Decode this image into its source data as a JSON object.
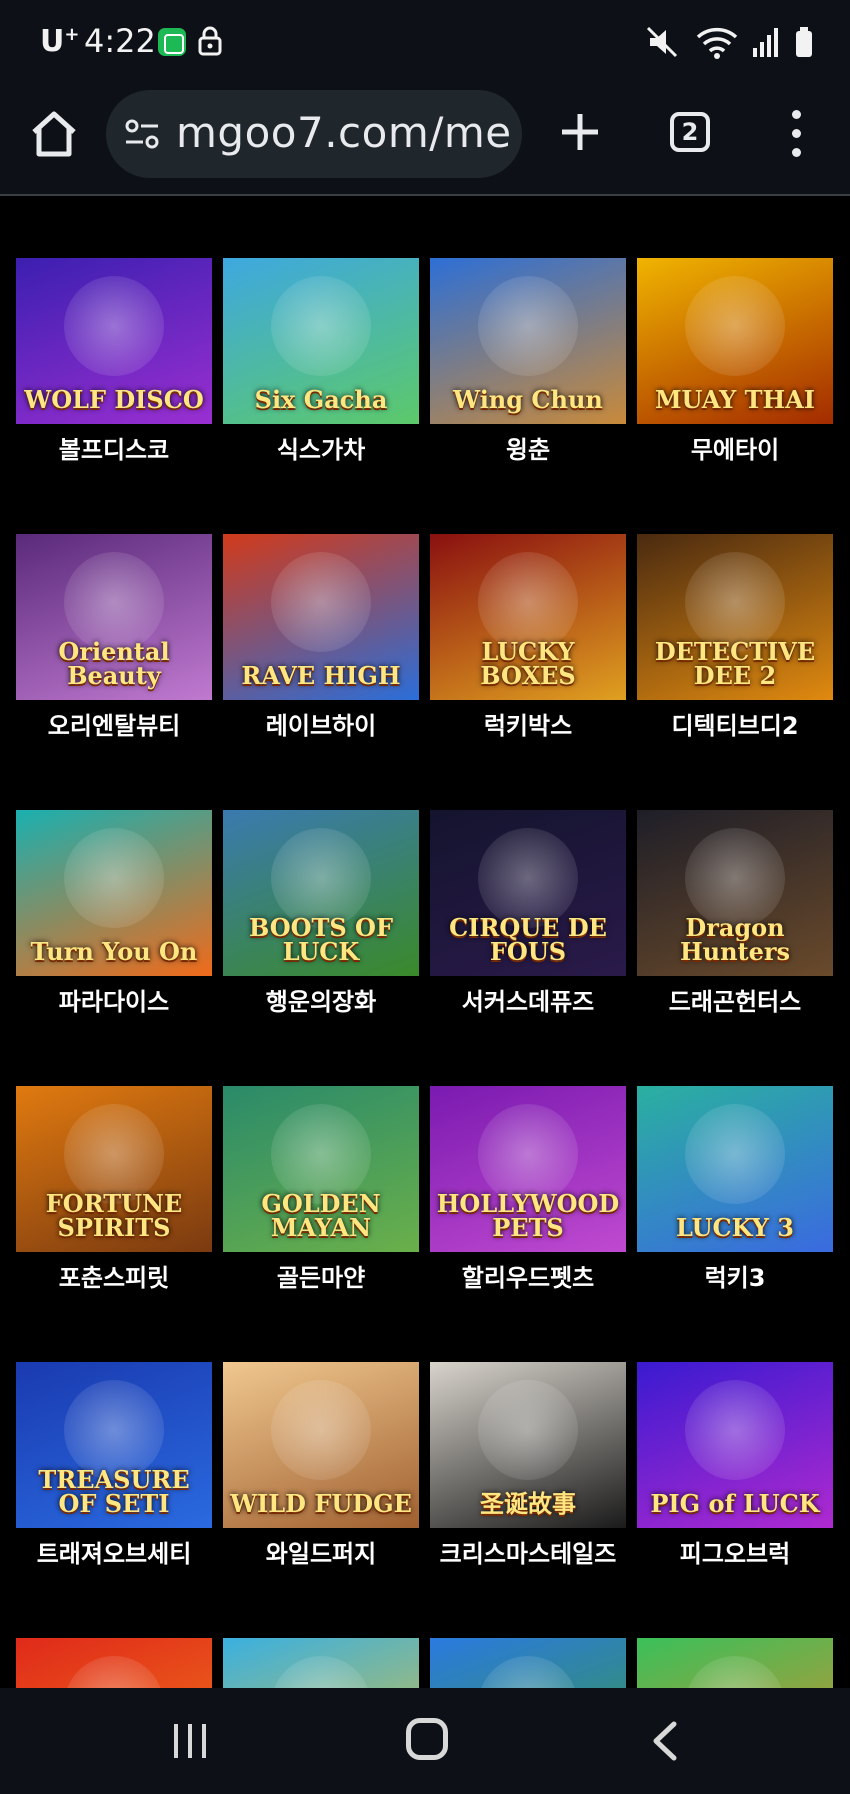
{
  "status": {
    "carrier": "U",
    "carrier_sup": "+",
    "time": "4:22"
  },
  "browser": {
    "url": "mgoo7.com/me",
    "tab_count": "2"
  },
  "games": [
    {
      "name": "볼프디스코",
      "art_text": "WOLF DISCO",
      "colors": [
        "#3b1fb0",
        "#9a2fd1"
      ]
    },
    {
      "name": "식스가차",
      "art_text": "Six Gacha",
      "colors": [
        "#3ea8e0",
        "#5cc96a"
      ]
    },
    {
      "name": "윙춘",
      "art_text": "Wing Chun",
      "colors": [
        "#2d6fd6",
        "#c98a3a"
      ]
    },
    {
      "name": "무에타이",
      "art_text": "MUAY THAI",
      "colors": [
        "#f0b400",
        "#a32b00"
      ]
    },
    {
      "name": "오리엔탈뷰티",
      "art_text": "Oriental Beauty",
      "colors": [
        "#5a2a7a",
        "#c07ad0"
      ]
    },
    {
      "name": "레이브하이",
      "art_text": "RAVE HIGH",
      "colors": [
        "#d13a1a",
        "#2a6ed9"
      ]
    },
    {
      "name": "럭키박스",
      "art_text": "LUCKY BOXES",
      "colors": [
        "#8a1010",
        "#e0a020"
      ]
    },
    {
      "name": "디텍티브디2",
      "art_text": "DETECTIVE DEE 2",
      "colors": [
        "#4a2a10",
        "#e08a10"
      ]
    },
    {
      "name": "파라다이스",
      "art_text": "Turn You On",
      "colors": [
        "#1ab0b0",
        "#f06a1a"
      ]
    },
    {
      "name": "행운의장화",
      "art_text": "BOOTS OF LUCK",
      "colors": [
        "#3a7ab0",
        "#3a8a2a"
      ]
    },
    {
      "name": "서커스데퓨즈",
      "art_text": "CIRQUE DE FOUS",
      "colors": [
        "#14142e",
        "#2a1a4a"
      ]
    },
    {
      "name": "드래곤헌터스",
      "art_text": "Dragon Hunters",
      "colors": [
        "#1e1e28",
        "#6a4a2a"
      ]
    },
    {
      "name": "포춘스피릿",
      "art_text": "FORTUNE SPIRITS",
      "colors": [
        "#e07a10",
        "#7a3a10"
      ]
    },
    {
      "name": "골든마얀",
      "art_text": "GOLDEN MAYAN",
      "colors": [
        "#2a8a6a",
        "#6ab04a"
      ]
    },
    {
      "name": "할리우드펫츠",
      "art_text": "HOLLYWOOD PETS",
      "colors": [
        "#7a1ab0",
        "#c04ad0"
      ]
    },
    {
      "name": "럭키3",
      "art_text": "LUCKY 3",
      "colors": [
        "#2ab0a0",
        "#3a6ae0"
      ]
    },
    {
      "name": "트래져오브세티",
      "art_text": "TREASURE OF SETI",
      "colors": [
        "#1a3ab0",
        "#2a6ae0"
      ]
    },
    {
      "name": "와일드퍼지",
      "art_text": "WILD FUDGE",
      "colors": [
        "#f0c890",
        "#a06030"
      ]
    },
    {
      "name": "크리스마스테일즈",
      "art_text": "圣诞故事",
      "colors": [
        "#d8d4cc",
        "#1a1a1a"
      ]
    },
    {
      "name": "피그오브럭",
      "art_text": "PIG of LUCK",
      "colors": [
        "#3a1ad0",
        "#b02ad0"
      ]
    },
    {
      "name": "",
      "art_text": "",
      "colors": [
        "#e02a1a",
        "#f07a1a"
      ]
    },
    {
      "name": "",
      "art_text": "",
      "colors": [
        "#3ab0e0",
        "#e0c03a"
      ]
    },
    {
      "name": "",
      "art_text": "",
      "colors": [
        "#2a7ae0",
        "#3a9a3a"
      ]
    },
    {
      "name": "",
      "art_text": "",
      "colors": [
        "#3ac05a",
        "#e08a2a"
      ]
    }
  ]
}
